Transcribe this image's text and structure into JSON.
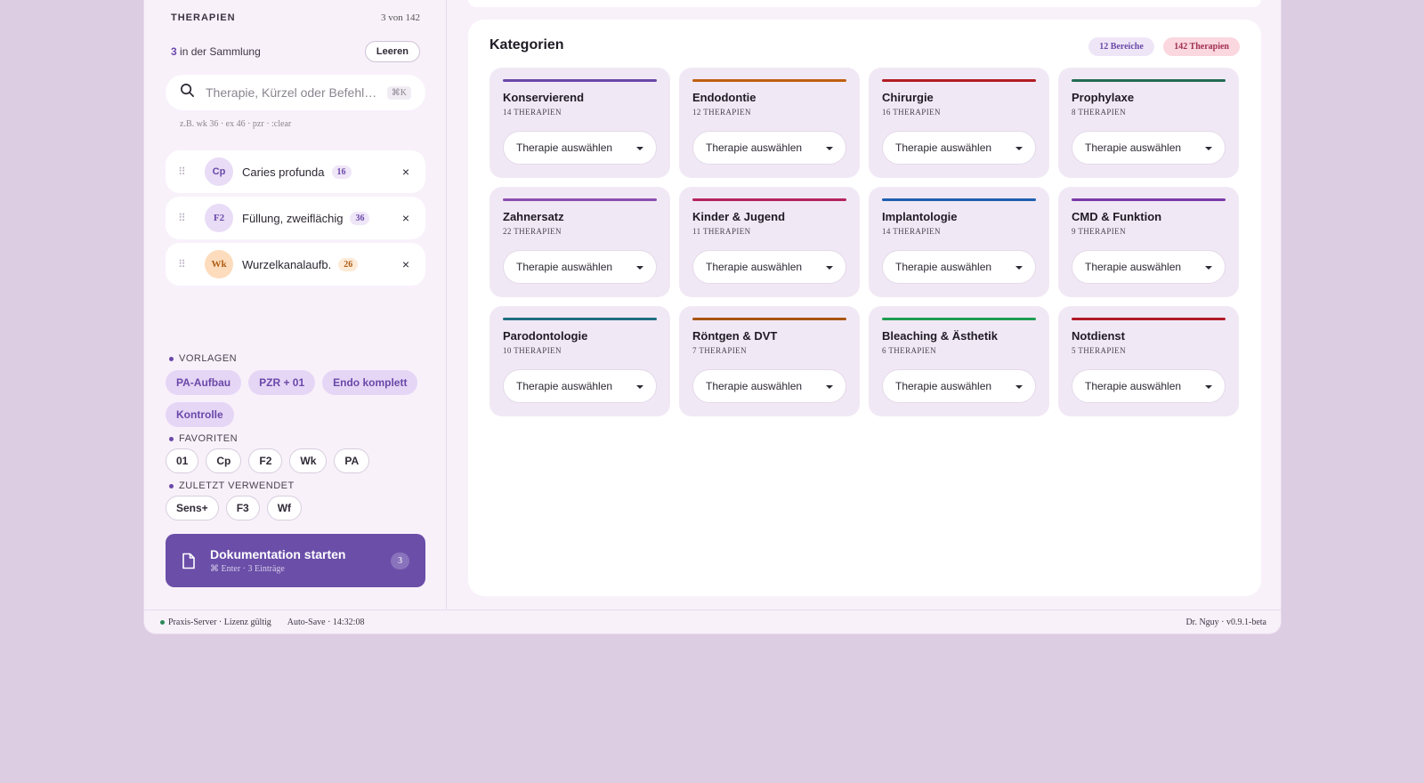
{
  "sidebar": {
    "title": "THERAPIEN",
    "count": "3 von 142",
    "collection_count": "3",
    "collection_text": "in der Sammlung",
    "clear_label": "Leeren",
    "search": {
      "placeholder": "Therapie, Kürzel oder Befehl…",
      "shortcut": "⌘K",
      "hint": "z.B. wk 36 · ex 46 · pzr · :clear"
    },
    "selected": [
      {
        "abbr": "Cp",
        "name": "Caries profunda",
        "code": "16",
        "color": "purple"
      },
      {
        "abbr": "F2",
        "name": "Füllung, zweiflächig",
        "code": "36",
        "color": "purple"
      },
      {
        "abbr": "Wk",
        "name": "Wurzelkanalaufb.",
        "code": "26",
        "color": "orange"
      }
    ],
    "templates_label": "VORLAGEN",
    "templates": [
      "PA-Aufbau",
      "PZR + 01",
      "Endo komplett",
      "Kontrolle"
    ],
    "favorites_label": "FAVORITEN",
    "favorites": [
      "01",
      "Cp",
      "F2",
      "Wk",
      "PA"
    ],
    "recent_label": "ZULETZT VERWENDET",
    "recent": [
      "Sens+",
      "F3",
      "Wf"
    ],
    "doc_button": {
      "title": "Dokumentation starten",
      "sub": "⌘ Enter · 3 Einträge",
      "badge": "3"
    }
  },
  "main": {
    "title": "Kategorien",
    "pill_areas": "12 Bereiche",
    "pill_therapies": "142 Therapien",
    "select_placeholder": "Therapie auswählen",
    "categories": [
      {
        "name": "Konservierend",
        "count": "14 THERAPIEN",
        "color": "#6a48a8"
      },
      {
        "name": "Endodontie",
        "count": "12 THERAPIEN",
        "color": "#c0600f"
      },
      {
        "name": "Chirurgie",
        "count": "16 THERAPIEN",
        "color": "#b21c24"
      },
      {
        "name": "Prophylaxe",
        "count": "8 THERAPIEN",
        "color": "#236c52"
      },
      {
        "name": "Zahnersatz",
        "count": "22 THERAPIEN",
        "color": "#8b4fb0"
      },
      {
        "name": "Kinder & Jugend",
        "count": "11 THERAPIEN",
        "color": "#b4245c"
      },
      {
        "name": "Implantologie",
        "count": "14 THERAPIEN",
        "color": "#1e5fb0"
      },
      {
        "name": "CMD & Funktion",
        "count": "9 THERAPIEN",
        "color": "#7a3aa8"
      },
      {
        "name": "Parodontologie",
        "count": "10 THERAPIEN",
        "color": "#1f6e80"
      },
      {
        "name": "Röntgen & DVT",
        "count": "7 THERAPIEN",
        "color": "#a8560f"
      },
      {
        "name": "Bleaching & Ästhetik",
        "count": "6 THERAPIEN",
        "color": "#1f9e52"
      },
      {
        "name": "Notdienst",
        "count": "5 THERAPIEN",
        "color": "#b01c28"
      }
    ]
  },
  "footer": {
    "server": "Praxis-Server · Lizenz gültig",
    "autosave": "Auto-Save · 14:32:08",
    "user": "Dr. Nguy · v0.9.1-beta"
  }
}
